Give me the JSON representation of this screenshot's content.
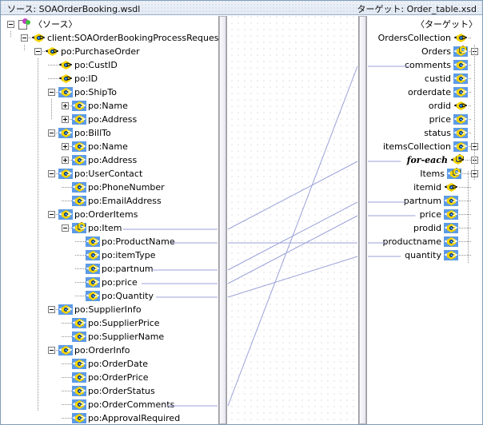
{
  "header": {
    "source_label": "ソース: SOAOrderBooking.wsdl",
    "target_label": "ターゲット: Order_table.xsd"
  },
  "colors": {
    "link": "#9aa2d8",
    "selection": "#5c9ae6",
    "icon_fill": "#f5d400",
    "icon_pupil": "#1b6ec6",
    "header_bg": "#e3eaf4"
  },
  "source_tree": {
    "root_icon": "source-root-icon",
    "nodes": [
      {
        "label": "〈ソース〉",
        "depth": 0,
        "icon": "source-root-icon",
        "expander": "minus",
        "selected": false
      },
      {
        "label": "client:SOAOrderBookingProcessRequest",
        "depth": 1,
        "icon": "element-icon",
        "expander": "minus",
        "selected": false
      },
      {
        "label": "po:PurchaseOrder",
        "depth": 2,
        "icon": "element-icon",
        "expander": "minus",
        "selected": false
      },
      {
        "label": "po:CustID",
        "depth": 3,
        "icon": "element-icon",
        "expander": "none",
        "selected": false
      },
      {
        "label": "po:ID",
        "depth": 3,
        "icon": "element-icon",
        "expander": "none",
        "selected": false
      },
      {
        "label": "po:ShipTo",
        "depth": 3,
        "icon": "element-icon",
        "expander": "minus",
        "selected": true
      },
      {
        "label": "po:Name",
        "depth": 4,
        "icon": "element-icon",
        "expander": "plus",
        "selected": true
      },
      {
        "label": "po:Address",
        "depth": 4,
        "icon": "element-icon",
        "expander": "plus",
        "selected": true
      },
      {
        "label": "po:BillTo",
        "depth": 3,
        "icon": "element-icon",
        "expander": "minus",
        "selected": true
      },
      {
        "label": "po:Name",
        "depth": 4,
        "icon": "element-icon",
        "expander": "plus",
        "selected": true
      },
      {
        "label": "po:Address",
        "depth": 4,
        "icon": "element-icon",
        "expander": "plus",
        "selected": true
      },
      {
        "label": "po:UserContact",
        "depth": 3,
        "icon": "element-icon",
        "expander": "minus",
        "selected": true
      },
      {
        "label": "po:PhoneNumber",
        "depth": 4,
        "icon": "element-icon",
        "expander": "none",
        "selected": true
      },
      {
        "label": "po:EmailAddress",
        "depth": 4,
        "icon": "element-icon",
        "expander": "none",
        "selected": true
      },
      {
        "label": "po:OrderItems",
        "depth": 3,
        "icon": "element-icon",
        "expander": "minus",
        "selected": true
      },
      {
        "label": "po:Item",
        "depth": 4,
        "icon": "repeating-element-icon",
        "expander": "minus",
        "selected": true
      },
      {
        "label": "po:ProductName",
        "depth": 5,
        "icon": "element-icon",
        "expander": "none",
        "selected": true
      },
      {
        "label": "po:itemType",
        "depth": 5,
        "icon": "element-icon",
        "expander": "none",
        "selected": true
      },
      {
        "label": "po:partnum",
        "depth": 5,
        "icon": "element-icon",
        "expander": "none",
        "selected": true
      },
      {
        "label": "po:price",
        "depth": 5,
        "icon": "element-icon",
        "expander": "none",
        "selected": true
      },
      {
        "label": "po:Quantity",
        "depth": 5,
        "icon": "element-icon",
        "expander": "none",
        "selected": true
      },
      {
        "label": "po:SupplierInfo",
        "depth": 3,
        "icon": "element-icon",
        "expander": "minus",
        "selected": true
      },
      {
        "label": "po:SupplierPrice",
        "depth": 4,
        "icon": "element-icon",
        "expander": "none",
        "selected": true
      },
      {
        "label": "po:SupplierName",
        "depth": 4,
        "icon": "element-icon",
        "expander": "none",
        "selected": true
      },
      {
        "label": "po:OrderInfo",
        "depth": 3,
        "icon": "element-icon",
        "expander": "minus",
        "selected": true
      },
      {
        "label": "po:OrderDate",
        "depth": 4,
        "icon": "element-icon",
        "expander": "none",
        "selected": true
      },
      {
        "label": "po:OrderPrice",
        "depth": 4,
        "icon": "element-icon",
        "expander": "none",
        "selected": true
      },
      {
        "label": "po:OrderStatus",
        "depth": 4,
        "icon": "element-icon",
        "expander": "none",
        "selected": true
      },
      {
        "label": "po:OrderComments",
        "depth": 4,
        "icon": "element-icon",
        "expander": "none",
        "selected": true
      },
      {
        "label": "po:ApprovalRequired",
        "depth": 4,
        "icon": "element-icon",
        "expander": "none",
        "selected": true
      }
    ]
  },
  "target_tree": {
    "nodes": [
      {
        "label": "〈ターゲット〉",
        "depth": 0,
        "icon": "none",
        "expander": "none",
        "selected": false
      },
      {
        "label": "OrdersCollection",
        "depth": 1,
        "icon": "element-icon",
        "expander": "none",
        "selected": false
      },
      {
        "label": "Orders",
        "depth": 2,
        "icon": "repeating-element-icon",
        "expander": "minus",
        "selected": true
      },
      {
        "label": "comments",
        "depth": 3,
        "icon": "element-icon",
        "expander": "none",
        "selected": true
      },
      {
        "label": "custid",
        "depth": 3,
        "icon": "element-icon",
        "expander": "none",
        "selected": true
      },
      {
        "label": "orderdate",
        "depth": 3,
        "icon": "element-icon",
        "expander": "none",
        "selected": true
      },
      {
        "label": "ordid",
        "depth": 3,
        "icon": "element-icon",
        "expander": "none",
        "selected": false
      },
      {
        "label": "price",
        "depth": 3,
        "icon": "element-icon",
        "expander": "none",
        "selected": true
      },
      {
        "label": "status",
        "depth": 3,
        "icon": "element-icon",
        "expander": "none",
        "selected": true
      },
      {
        "label": "itemsCollection",
        "depth": 3,
        "icon": "element-icon",
        "expander": "minus",
        "selected": true
      },
      {
        "label": "for-each",
        "depth": 4,
        "icon": "repeating-element-icon",
        "expander": "minus",
        "selected": false,
        "style": "bold-italic"
      },
      {
        "label": "Items",
        "depth": 5,
        "icon": "repeating-element-icon",
        "expander": "minus",
        "selected": true
      },
      {
        "label": "itemid",
        "depth": 6,
        "icon": "element-icon",
        "expander": "none",
        "selected": false
      },
      {
        "label": "partnum",
        "depth": 6,
        "icon": "element-icon",
        "expander": "none",
        "selected": true
      },
      {
        "label": "price",
        "depth": 6,
        "icon": "element-icon",
        "expander": "none",
        "selected": true
      },
      {
        "label": "prodid",
        "depth": 6,
        "icon": "element-icon",
        "expander": "none",
        "selected": true
      },
      {
        "label": "productname",
        "depth": 6,
        "icon": "element-icon",
        "expander": "none",
        "selected": true
      },
      {
        "label": "quantity",
        "depth": 6,
        "icon": "element-icon",
        "expander": "none",
        "selected": true
      }
    ]
  },
  "mappings": [
    {
      "from": "po:Item",
      "to": "for-each"
    },
    {
      "from": "po:ProductName",
      "to": "productname"
    },
    {
      "from": "po:partnum",
      "to": "partnum"
    },
    {
      "from": "po:price",
      "to": "price"
    },
    {
      "from": "po:Quantity",
      "to": "quantity"
    },
    {
      "from": "po:OrderComments",
      "to": "comments"
    }
  ]
}
